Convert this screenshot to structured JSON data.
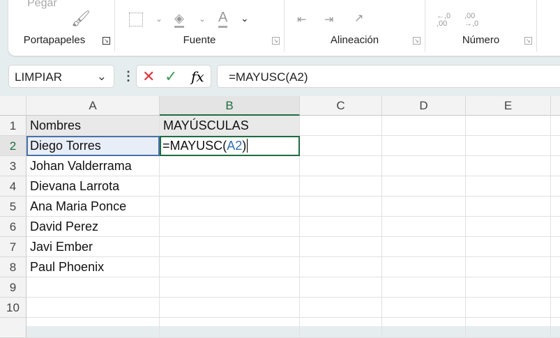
{
  "ribbon": {
    "groups": [
      {
        "label": "Portapapeles",
        "extra": "Pegar"
      },
      {
        "label": "Fuente"
      },
      {
        "label": "Alineación"
      },
      {
        "label": "Número",
        "dec1": "←,0 ,00",
        "dec2": ",00 →,0"
      }
    ]
  },
  "formula_bar": {
    "name_box": "LIMPIAR",
    "formula": "=MAYUSC(A2)",
    "fx": "fx"
  },
  "sheet": {
    "columns": [
      "A",
      "B",
      "C",
      "D",
      "E"
    ],
    "rows": [
      "1",
      "2",
      "3",
      "4",
      "5",
      "6",
      "7",
      "8",
      "9",
      "10"
    ],
    "A": [
      "Nombres",
      "Diego Torres",
      "Johan Valderrama",
      "Dievana Larrota",
      "Ana Maria Ponce",
      "David Perez",
      "Javi Ember",
      "Paul Phoenix",
      "",
      ""
    ],
    "B1": "MAYÚSCULAS",
    "B2_parts": {
      "prefix": "=MAYUSC(",
      "ref": "A2",
      "suffix": ")"
    }
  }
}
